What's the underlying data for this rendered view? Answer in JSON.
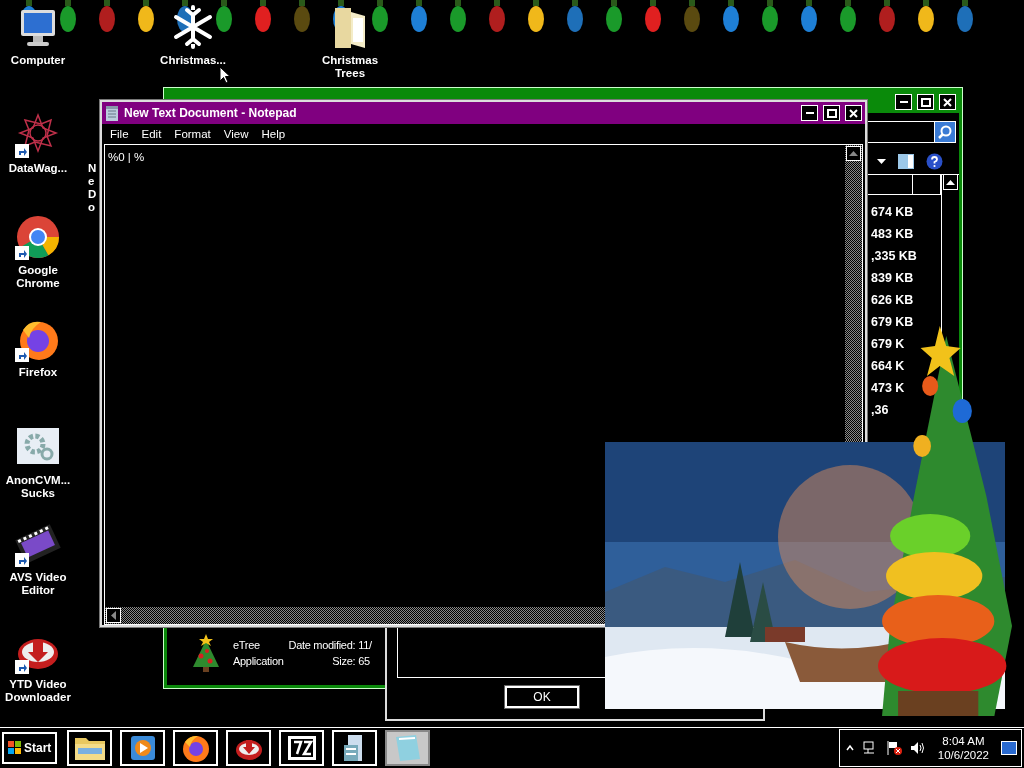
{
  "desktop_icons": [
    {
      "label": "Computer",
      "kind": "computer",
      "shortcut": false
    },
    {
      "label": "Christmas...",
      "kind": "snowflake",
      "shortcut": false
    },
    {
      "label": "Christmas Trees",
      "kind": "folder",
      "shortcut": false
    },
    {
      "label": "DataWag...",
      "kind": "mandala",
      "shortcut": true
    },
    {
      "label": "Ne Do",
      "kind": "hidden"
    },
    {
      "label": "Google Chrome",
      "kind": "chrome",
      "shortcut": true
    },
    {
      "label": "Firefox",
      "kind": "firefox",
      "shortcut": true
    },
    {
      "label": "AnonCVM... Sucks",
      "kind": "gear",
      "shortcut": false
    },
    {
      "label": "AVS Video Editor",
      "kind": "film",
      "shortcut": true
    },
    {
      "label": "YTD Video Downloader",
      "kind": "download",
      "shortcut": true
    }
  ],
  "explorer": {
    "sizes": [
      "674 KB",
      "483 KB",
      ",335 KB",
      "839 KB",
      "626 KB",
      "679 KB",
      "679 K",
      "664 K",
      "473 K",
      ",36"
    ],
    "details": {
      "name": "eTree",
      "type": "Application",
      "date_label": "Date modified:",
      "date": "11/",
      "size_label": "Size:",
      "size": "65"
    }
  },
  "dialog": {
    "buttons": [
      "OK"
    ]
  },
  "notepad": {
    "title": "New Text Document - Notepad",
    "menu": [
      "File",
      "Edit",
      "Format",
      "View",
      "Help"
    ],
    "text": "%0 | %"
  },
  "taskbar": {
    "start": "Start",
    "apps": [
      {
        "kind": "explorer",
        "selected": false
      },
      {
        "kind": "media",
        "selected": false
      },
      {
        "kind": "firefox",
        "selected": false
      },
      {
        "kind": "download",
        "selected": false
      },
      {
        "kind": "sevenzip",
        "selected": false
      },
      {
        "kind": "document",
        "selected": false
      },
      {
        "kind": "notepad",
        "selected": true
      }
    ],
    "time": "8:04 AM",
    "date": "10/6/2022"
  }
}
